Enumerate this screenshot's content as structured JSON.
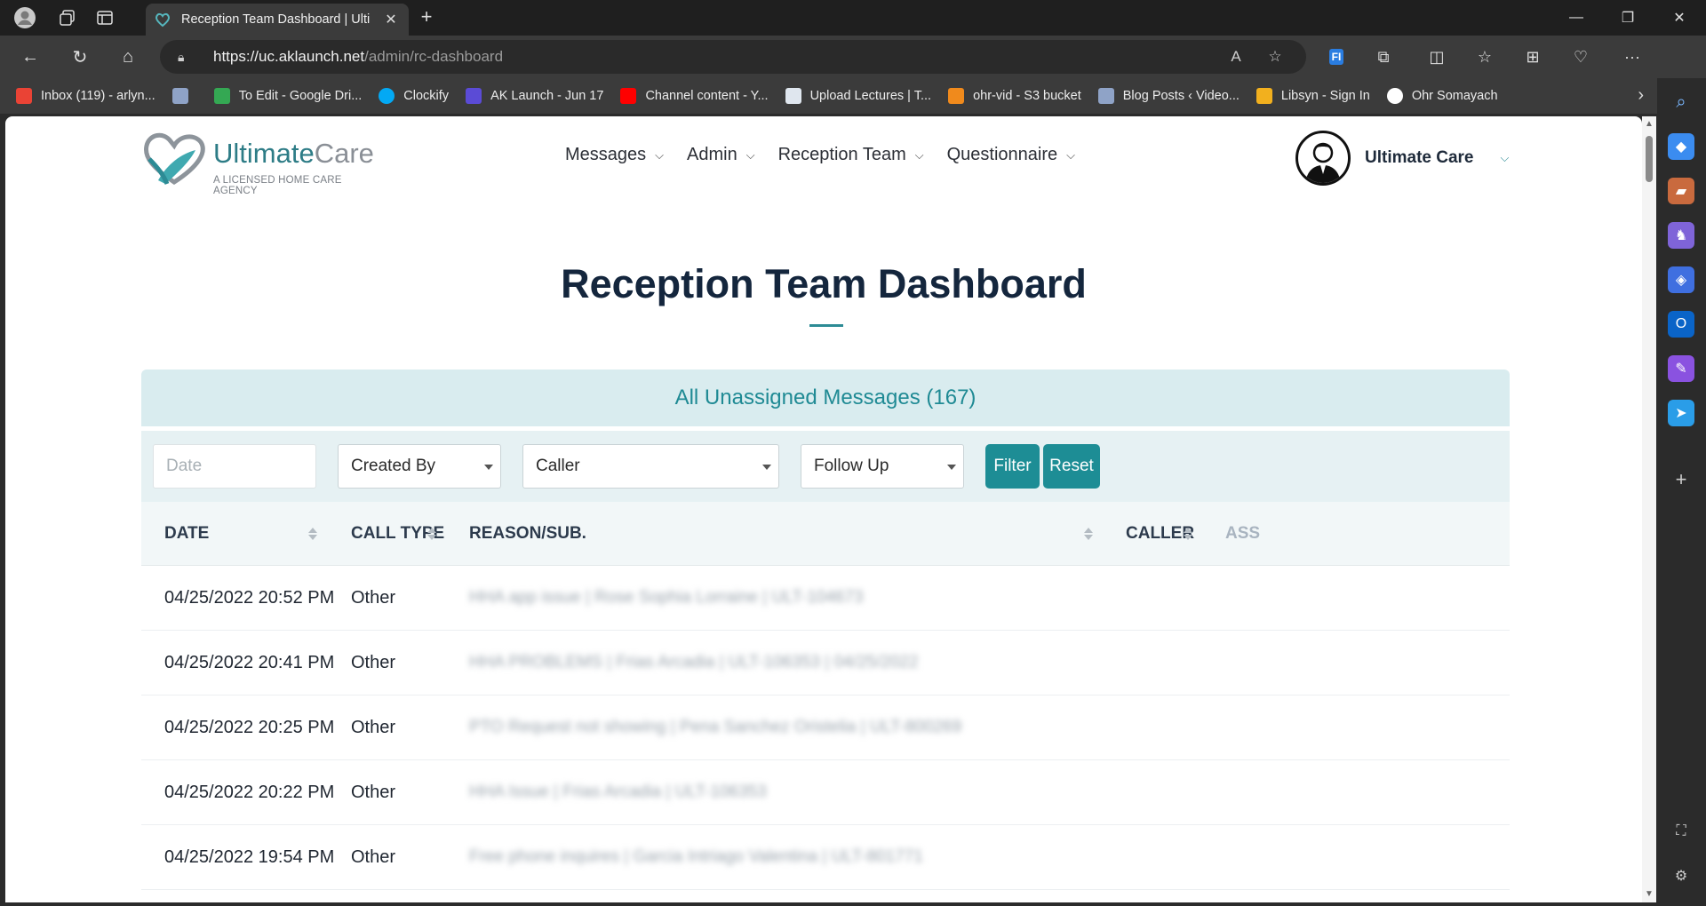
{
  "browser": {
    "tab_title": "Reception Team Dashboard | Ulti",
    "url_host": "https://uc.aklaunch.net",
    "url_path": "/admin/rc-dashboard"
  },
  "bookmarks": [
    {
      "label": "Inbox (119) - arlyn...",
      "color": "#ea4335"
    },
    {
      "label": "",
      "color": "#8fa3c7"
    },
    {
      "label": "To Edit - Google Dri...",
      "color": "#34a853"
    },
    {
      "label": "Clockify",
      "color": "#03a9f4"
    },
    {
      "label": "AK Launch - Jun 17",
      "color": "#5b4bd6"
    },
    {
      "label": "Channel content - Y...",
      "color": "#ff0000"
    },
    {
      "label": "Upload Lectures | T...",
      "color": "#dfe6ee"
    },
    {
      "label": "ohr-vid - S3 bucket",
      "color": "#f08a1c"
    },
    {
      "label": "Blog Posts ‹ Video...",
      "color": "#8fa3c7"
    },
    {
      "label": "Libsyn - Sign In",
      "color": "#f2b01e"
    },
    {
      "label": "Ohr Somayach",
      "color": "#ffffff"
    }
  ],
  "header": {
    "logo_main": "Ultimate",
    "logo_accent": "Care",
    "logo_tagline": "A LICENSED HOME CARE AGENCY",
    "nav": [
      "Messages",
      "Admin",
      "Reception Team",
      "Questionnaire"
    ],
    "user_name": "Ultimate Care"
  },
  "page": {
    "title": "Reception Team Dashboard",
    "panel_title": "All Unassigned Messages (167)"
  },
  "filters": {
    "date_placeholder": "Date",
    "created_by": "Created By",
    "caller": "Caller",
    "follow_up": "Follow Up",
    "filter_btn": "Filter",
    "reset_btn": "Reset"
  },
  "table": {
    "columns": [
      "DATE",
      "CALL TYPE",
      "REASON/SUB.",
      "CALLER",
      "ASS"
    ],
    "rows": [
      {
        "date": "04/25/2022 20:52 PM",
        "type": "Other",
        "reason": "HHA app issue | Rose Sophia Lorraine | ULT-104673"
      },
      {
        "date": "04/25/2022 20:41 PM",
        "type": "Other",
        "reason": "HHA PROBLEMS | Frias Arcadia | ULT-106353 | 04/25/2022"
      },
      {
        "date": "04/25/2022 20:25 PM",
        "type": "Other",
        "reason": "PTO Request not showing | Pena Sanchez Oristelia | ULT-800269"
      },
      {
        "date": "04/25/2022 20:22 PM",
        "type": "Other",
        "reason": "HHA Issue | Frias Arcadia | ULT-106353"
      },
      {
        "date": "04/25/2022 19:54 PM",
        "type": "Other",
        "reason": "Free phone inquires | Garcia Intriago Valentina | ULT-801771"
      }
    ]
  },
  "colors": {
    "accent": "#1d8d95",
    "title": "#14263d"
  }
}
